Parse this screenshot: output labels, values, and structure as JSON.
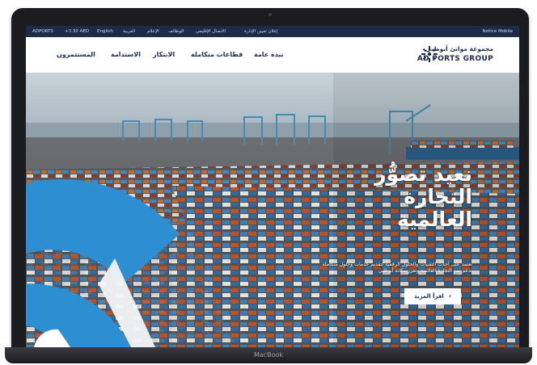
{
  "device": {
    "label": "MacBook"
  },
  "utility_bar": {
    "left_items": [
      "ADPORTS",
      "+3.30 AED",
      "English",
      "العربية",
      "الإعلام",
      "الوظائف",
      "الاتصال الإقليمي",
      "إعلان تعيين الإدارة"
    ],
    "right_label": "Notice Mobile"
  },
  "header": {
    "logo_ar": "مجموعة موانئ أبوظبي",
    "logo_en": "AD PORTS GROUP",
    "nav": [
      "نبذة عامة",
      "قطاعات متكاملة",
      "الابتكار",
      "الاستدامة",
      "المستثمرون"
    ]
  },
  "hero": {
    "headline_lines": [
      "نعيد تصوُّر",
      "التجارة",
      "العالمية"
    ],
    "subtitle": "نعتمد على أحدث التقنيات والحلول الرقمية لتقديم خدمات وحلول متكاملة تدعم نمو التجارة العالمية وتعزز مكانة أبوظبي",
    "cta_label": "اقرأ المزيد",
    "cta_icon": "chevron-left-icon"
  },
  "colors": {
    "navy": "#1d2a4a",
    "accent_blue": "#2d8fd1",
    "container_orange": "#c66a2e",
    "container_blue": "#3f89c2"
  }
}
